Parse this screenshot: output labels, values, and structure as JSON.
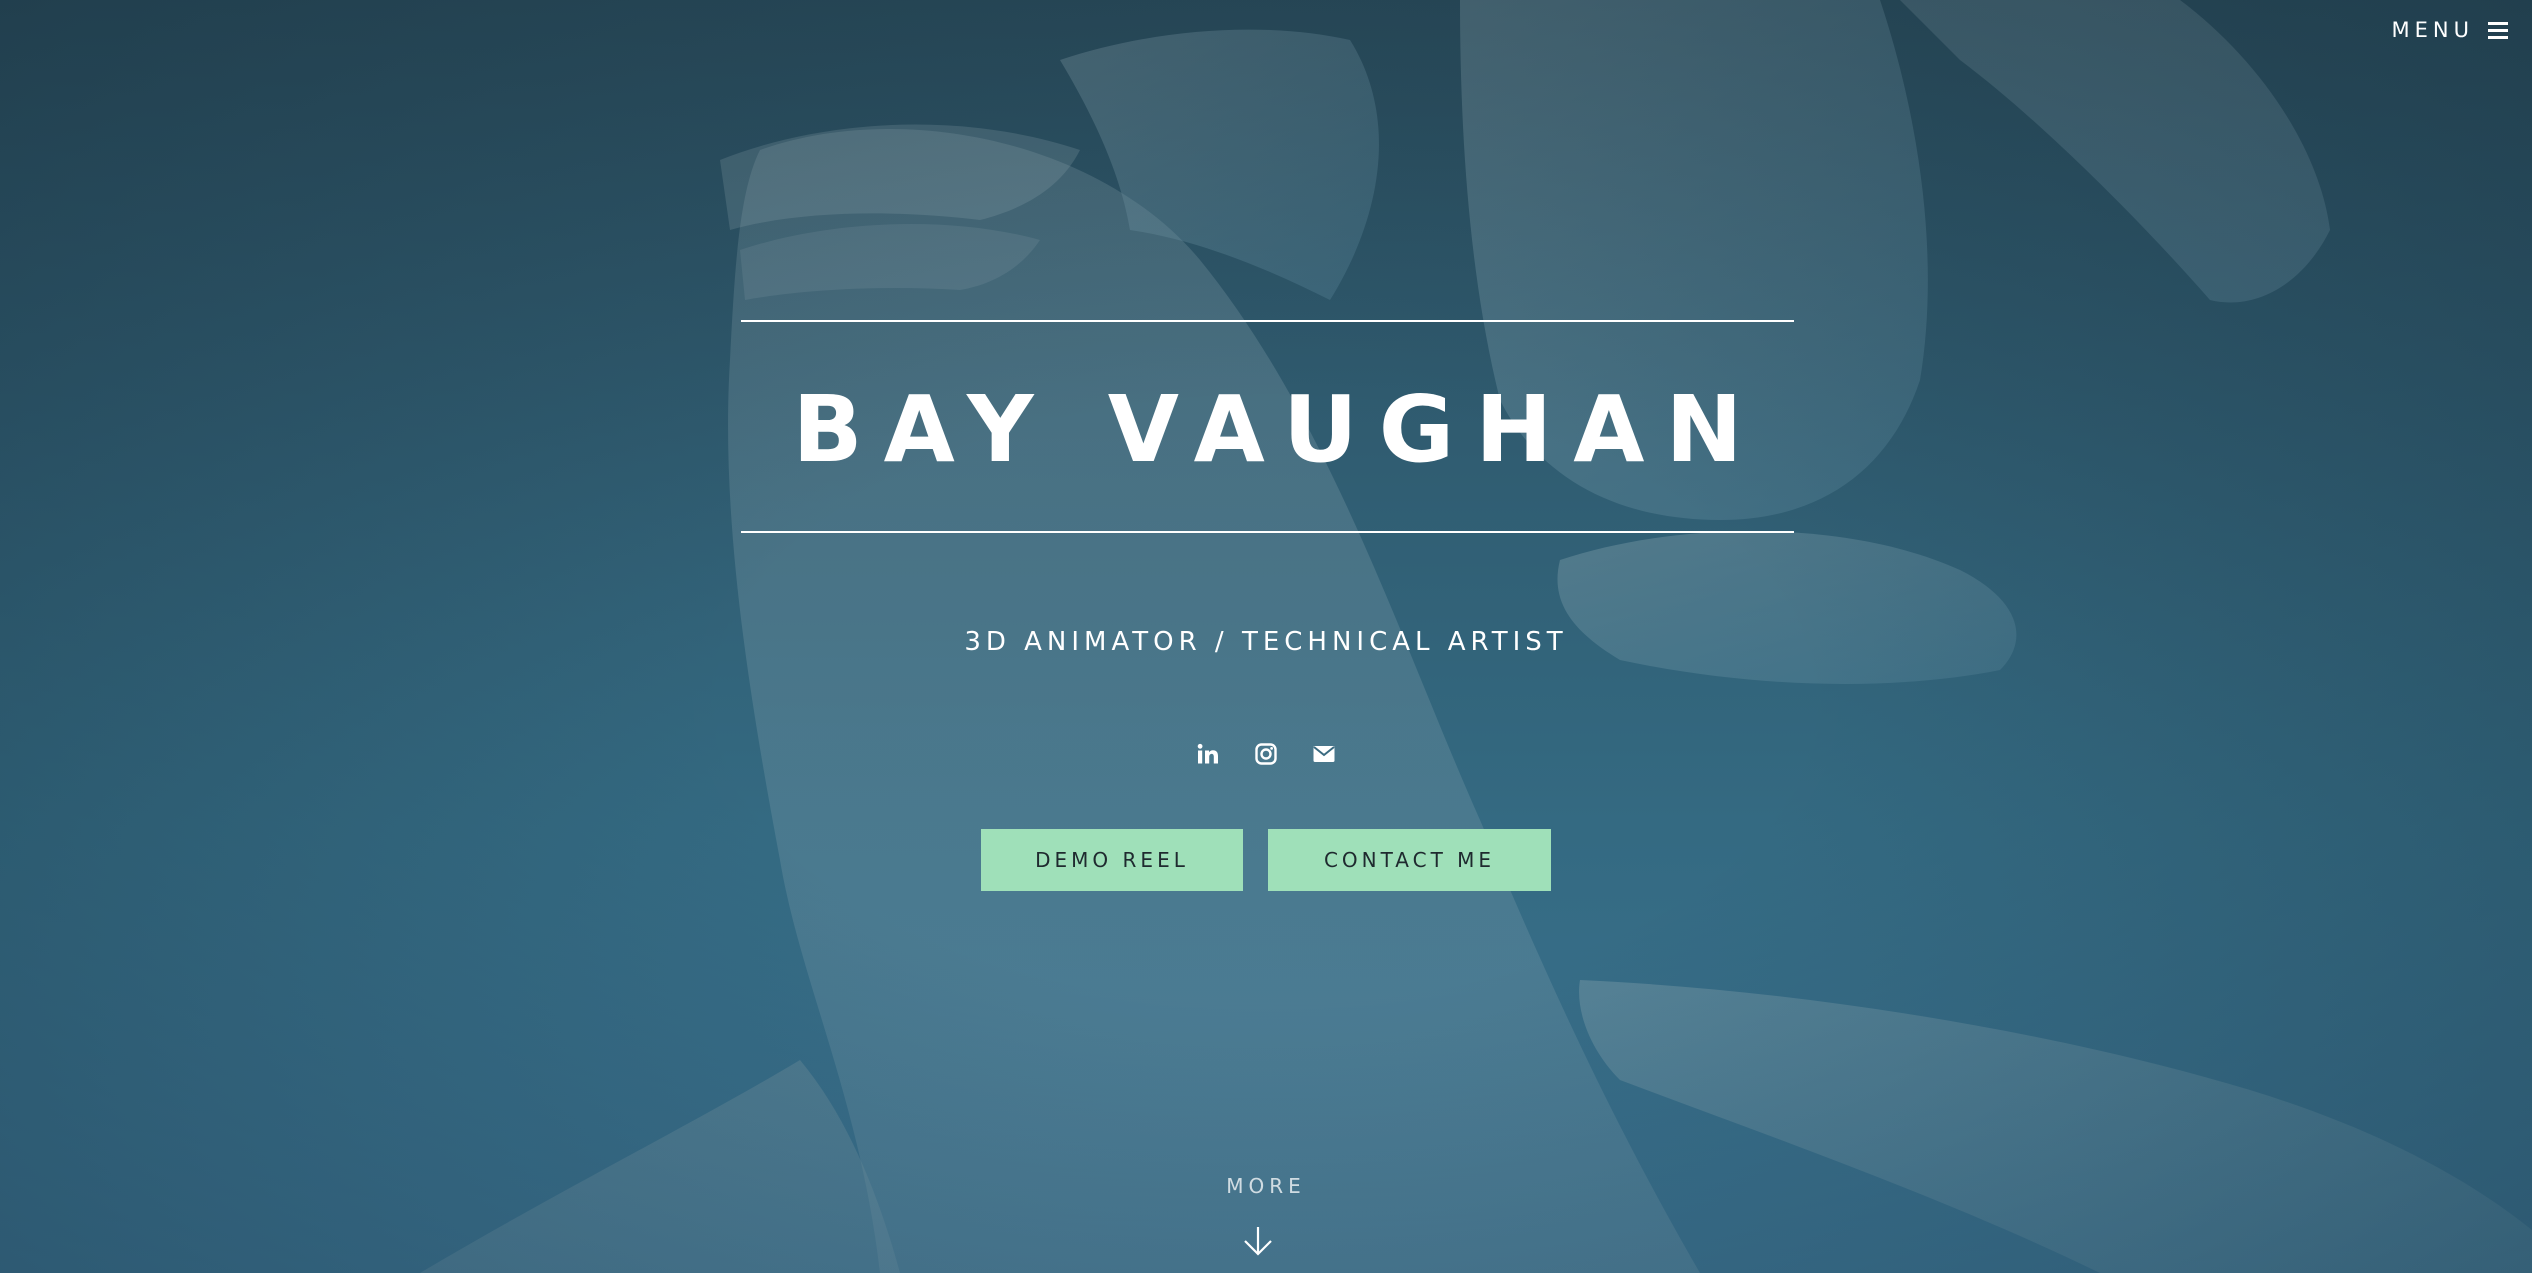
{
  "nav": {
    "menu_label": "MENU",
    "menu_icon": "hamburger-icon"
  },
  "hero": {
    "title": "BAY VAUGHAN",
    "subtitle": "3D ANIMATOR / TECHNICAL ARTIST",
    "social": [
      {
        "icon": "linkedin-icon"
      },
      {
        "icon": "instagram-icon"
      },
      {
        "icon": "envelope-icon"
      }
    ],
    "buttons": {
      "demo_reel": "DEMO REEL",
      "contact_me": "CONTACT ME"
    },
    "more_label": "MORE",
    "more_icon": "arrow-down-icon"
  },
  "colors": {
    "background": "#2f5a6e",
    "button": "#9fe0b9",
    "text": "#ffffff"
  }
}
